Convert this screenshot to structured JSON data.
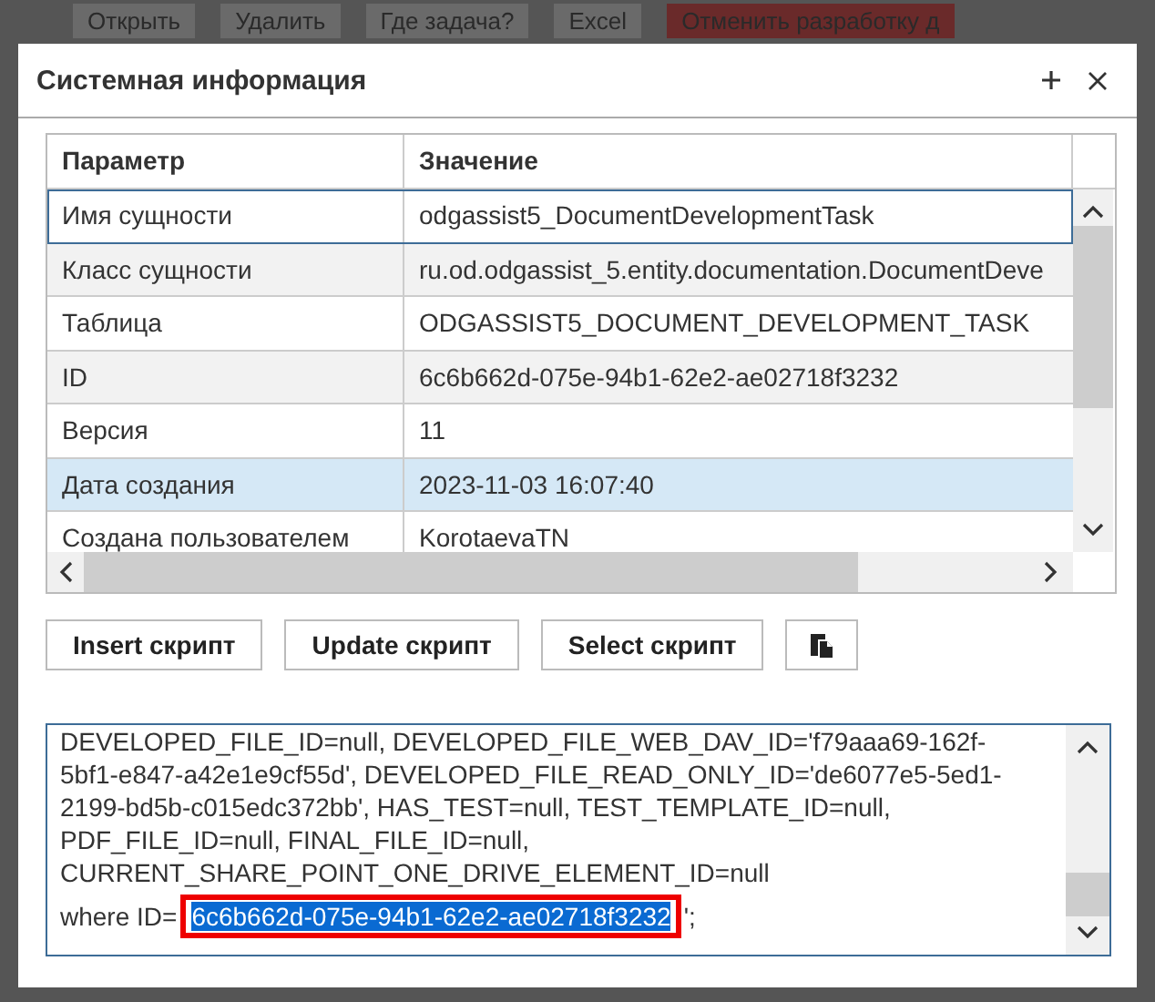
{
  "background_toolbar": [
    "Открыть",
    "Удалить",
    "Где задача?",
    "Excel",
    "Отменить разработку д"
  ],
  "dialog": {
    "title": "Системная информация"
  },
  "table": {
    "columns": [
      "Параметр",
      "Значение"
    ],
    "rows": [
      {
        "name": "Имя сущности",
        "value": "odgassist5_DocumentDevelopmentTask",
        "selected": false,
        "focused": true
      },
      {
        "name": "Класс сущности",
        "value": "ru.od.odgassist_5.entity.documentation.DocumentDeve",
        "selected": false,
        "focused": false
      },
      {
        "name": "Таблица",
        "value": "ODGASSIST5_DOCUMENT_DEVELOPMENT_TASK",
        "selected": false,
        "focused": false
      },
      {
        "name": "ID",
        "value": "6c6b662d-075e-94b1-62e2-ae02718f3232",
        "selected": false,
        "focused": false
      },
      {
        "name": "Версия",
        "value": "11",
        "selected": false,
        "focused": false
      },
      {
        "name": "Дата создания",
        "value": "2023-11-03 16:07:40",
        "selected": true,
        "focused": false
      },
      {
        "name": "Создана пользователем",
        "value": "KorotaevaTN",
        "selected": false,
        "focused": false
      }
    ]
  },
  "buttons": [
    "Insert скрипт",
    "Update скрипт",
    "Select скрипт"
  ],
  "script": {
    "text_before": "DEVELOPED_FILE_ID=null, DEVELOPED_FILE_WEB_DAV_ID='f79aaa69-162f-5bf1-e847-a42e1e9cf55d', DEVELOPED_FILE_READ_ONLY_ID='de6077e5-5ed1-2199-bd5b-c015edc372bb', HAS_TEST=null, TEST_TEMPLATE_ID=null, PDF_FILE_ID=null, FINAL_FILE_ID=null, CURRENT_SHARE_POINT_ONE_DRIVE_ELEMENT_ID=null\nwhere ID=",
    "selected_text": "6c6b662d-075e-94b1-62e2-ae02718f3232",
    "text_after": "';"
  }
}
